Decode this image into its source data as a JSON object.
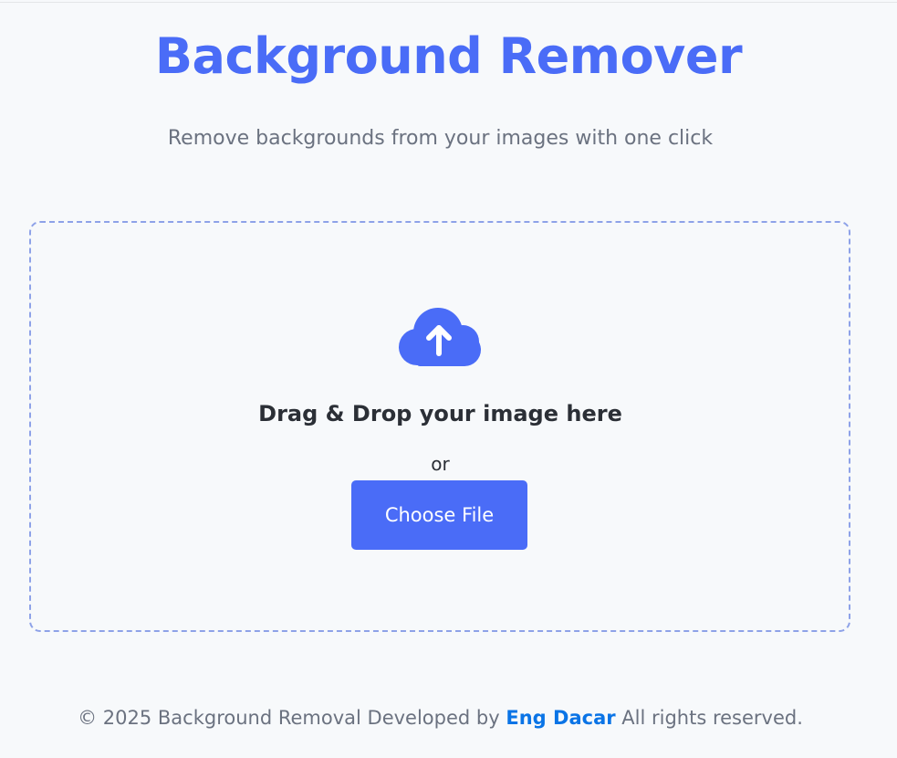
{
  "header": {
    "title": "Background Remover",
    "subtitle": "Remove backgrounds from your images with one click"
  },
  "upload": {
    "icon": "cloud-upload-icon",
    "drop_text": "Drag & Drop your image here",
    "or_text": "or",
    "button_label": "Choose File"
  },
  "footer": {
    "prefix": "© 2025 Background Removal Developed by",
    "author": "Eng Dacar",
    "suffix": "All rights reserved."
  },
  "colors": {
    "accent": "#4a6cf7",
    "link": "#0a74e6",
    "dropzone_border": "#8ea2e8",
    "background": "#f7f9fb"
  }
}
